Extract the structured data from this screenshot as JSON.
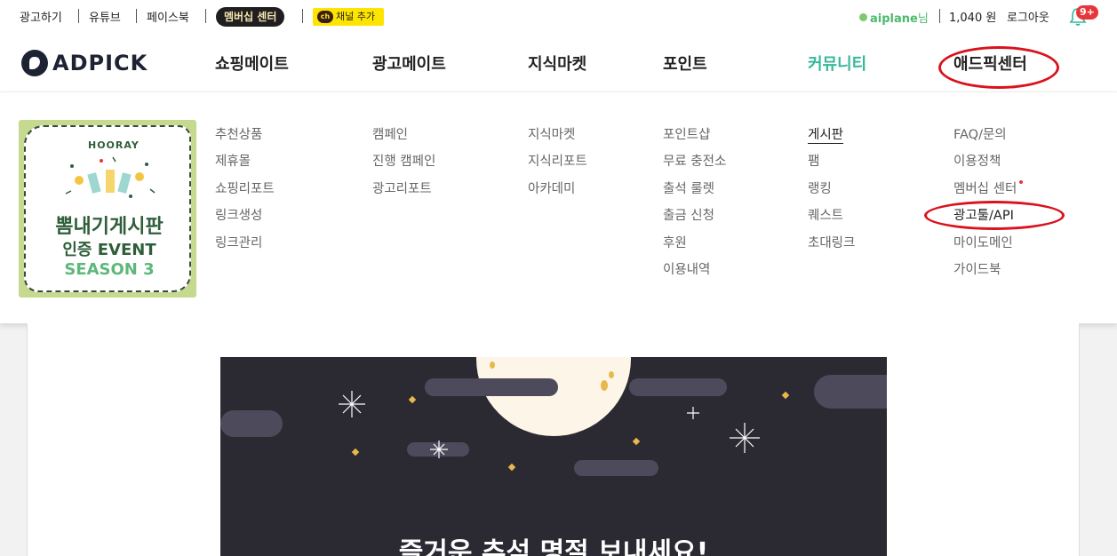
{
  "topbar": {
    "links": [
      "광고하기",
      "유튜브",
      "페이스북"
    ],
    "member_center": "멤버십 센터",
    "kakao_ch": "ch",
    "kakao_label": "채널 추가",
    "username": "aiplane",
    "username_suffix": "님",
    "points": "1,040 원",
    "logout": "로그아웃",
    "notifications": "9+"
  },
  "logo": {
    "text": "ADPICK"
  },
  "nav": [
    "쇼핑메이트",
    "광고메이트",
    "지식마켓",
    "포인트",
    "커뮤니티",
    "애드픽센터"
  ],
  "nav_active": "커뮤니티",
  "banner": {
    "hooray": "HOORAY",
    "line1": "뽐내기게시판",
    "line2": "인증 EVENT",
    "line3": "SEASON 3"
  },
  "menus": {
    "shopping": [
      "추천상품",
      "제휴몰",
      "쇼핑리포트",
      "링크생성",
      "링크관리"
    ],
    "ad": [
      "캠페인",
      "진행 캠페인",
      "광고리포트"
    ],
    "knowledge": [
      "지식마켓",
      "지식리포트",
      "아카데미"
    ],
    "point": [
      "포인트샵",
      "무료 충전소",
      "출석 룰렛",
      "출금 신청",
      "후원",
      "이용내역"
    ],
    "community": [
      "게시판",
      "팸",
      "랭킹",
      "퀘스트",
      "초대링크"
    ],
    "center": [
      "FAQ/문의",
      "이용정책",
      "멤버십 센터",
      "광고툴/API",
      "마이도메인",
      "가이드북"
    ]
  },
  "hero": {
    "title": "즐거운 추석 명절 보내세요!"
  },
  "colors": {
    "accent": "#35b89a",
    "annotation": "#d9121d",
    "kakao": "#fee500"
  }
}
